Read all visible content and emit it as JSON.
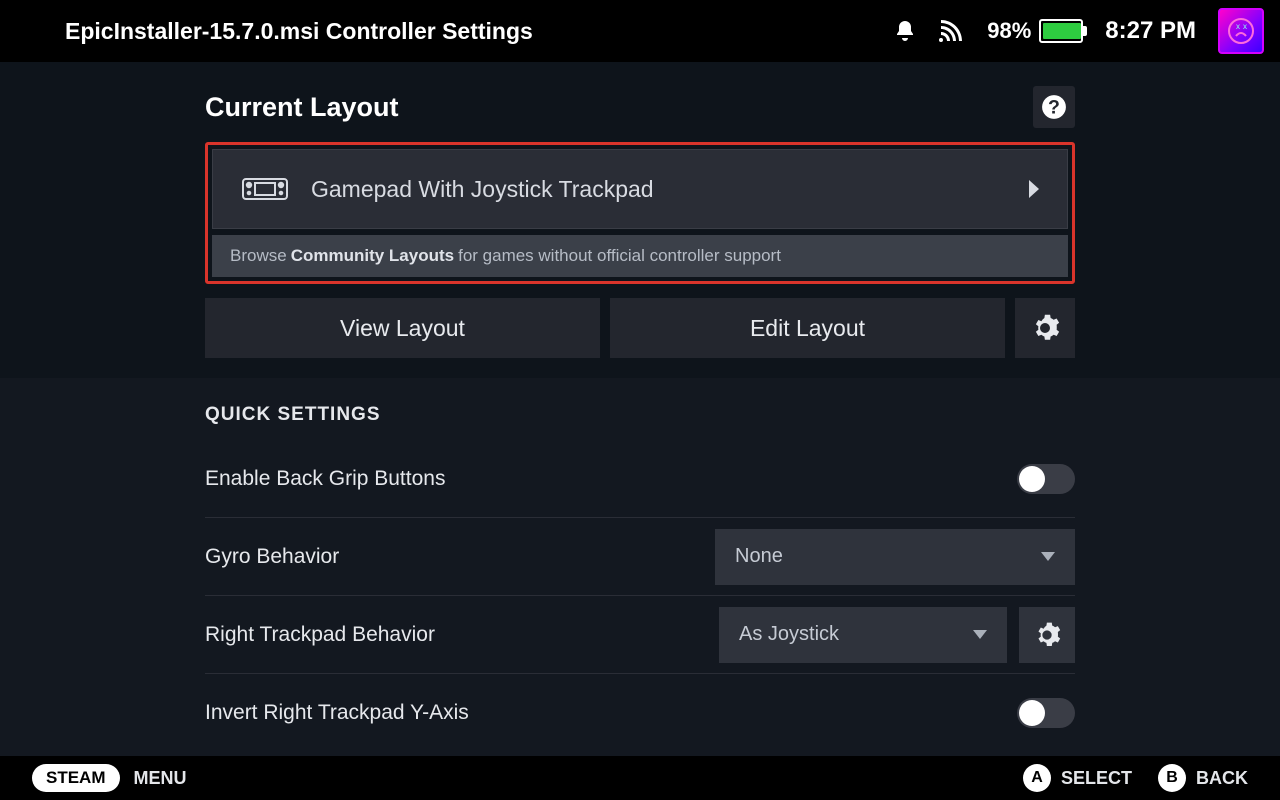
{
  "header": {
    "title": "EpicInstaller-15.7.0.msi Controller Settings",
    "battery_pct": "98%",
    "clock": "8:27 PM"
  },
  "layout": {
    "section_title": "Current Layout",
    "current": "Gamepad With Joystick Trackpad",
    "browse_prefix": "Browse",
    "browse_bold": "Community Layouts",
    "browse_suffix": "for games without official controller support",
    "view_btn": "View Layout",
    "edit_btn": "Edit Layout"
  },
  "quick": {
    "title": "QUICK SETTINGS",
    "rows": [
      {
        "label": "Enable Back Grip Buttons",
        "type": "toggle",
        "value": false
      },
      {
        "label": "Gyro Behavior",
        "type": "dropdown",
        "value": "None"
      },
      {
        "label": "Right Trackpad Behavior",
        "type": "dropdown_gear",
        "value": "As Joystick"
      },
      {
        "label": "Invert Right Trackpad Y-Axis",
        "type": "toggle",
        "value": false
      }
    ]
  },
  "footer": {
    "steam": "STEAM",
    "menu": "MENU",
    "select_btn": "A",
    "select_label": "SELECT",
    "back_btn": "B",
    "back_label": "BACK"
  }
}
